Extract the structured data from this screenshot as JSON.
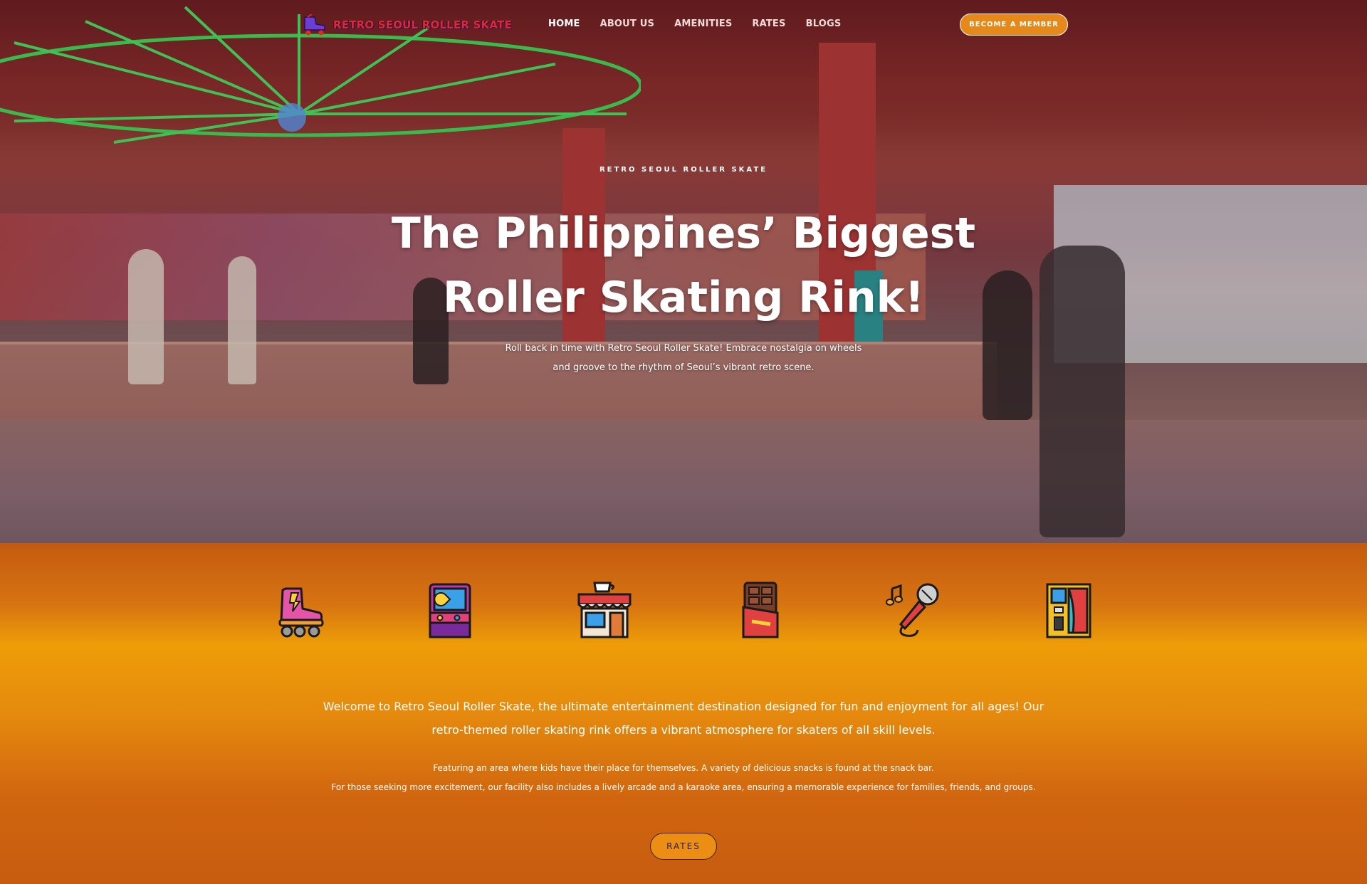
{
  "header": {
    "brand_name": "RETRO SEOUL ROLLER SKATE",
    "nav": [
      {
        "label": "HOME",
        "active": true
      },
      {
        "label": "ABOUT US",
        "active": false
      },
      {
        "label": "AMENITIES",
        "active": false
      },
      {
        "label": "RATES",
        "active": false
      },
      {
        "label": "BLOGS",
        "active": false
      }
    ],
    "cta_label": "BECOME A MEMBER"
  },
  "hero": {
    "eyebrow": "RETRO SEOUL ROLLER SKATE",
    "title_line1": "The Philippines’ Biggest",
    "title_line2": "Roller Skating Rink!",
    "subtitle_line1": "Roll back in time with Retro Seoul Roller Skate! Embrace nostalgia on wheels",
    "subtitle_line2": "and groove to the rhythm of Seoul’s vibrant retro scene."
  },
  "amenities": {
    "icons": [
      "roller-skate-icon",
      "arcade-machine-icon",
      "snack-bar-icon",
      "chocolate-bar-icon",
      "karaoke-microphone-icon",
      "photo-booth-icon"
    ]
  },
  "intro": {
    "welcome": "Welcome to Retro Seoul Roller Skate, the ultimate entertainment destination designed for fun and enjoyment for all ages! Our retro-themed roller skating rink offers a vibrant atmosphere for skaters of all skill levels.",
    "detail_line1": "Featuring an area where kids have their place for themselves. A variety of delicious snacks is found at the snack bar.",
    "detail_line2": "For those seeking more excitement, our facility also includes a lively arcade and a karaoke area, ensuring a memorable experience for families, friends, and groups.",
    "rates_label": "RATES"
  },
  "colors": {
    "accent": "#e5891a",
    "brand_red": "#e02a2a",
    "section_orange": "#ee9d08"
  }
}
